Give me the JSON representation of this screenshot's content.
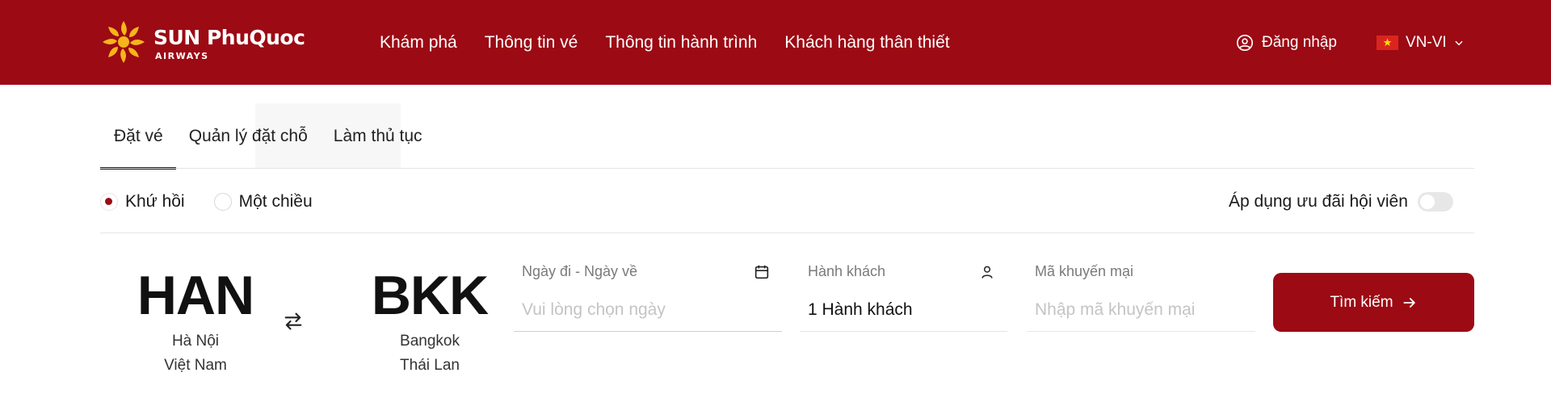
{
  "brand": {
    "name_sun": "SUN",
    "name_rest": "PhuQuoc",
    "sub": "AIRWAYS"
  },
  "nav": [
    {
      "label": "Khám phá"
    },
    {
      "label": "Thông tin vé"
    },
    {
      "label": "Thông tin hành trình"
    },
    {
      "label": "Khách hàng thân thiết"
    }
  ],
  "header": {
    "login_label": "Đăng nhập",
    "lang_label": "VN-VI"
  },
  "tabs": [
    {
      "label": "Đặt vé",
      "active": true
    },
    {
      "label": "Quản lý đặt chỗ",
      "active": false
    },
    {
      "label": "Làm thủ tục",
      "active": false
    }
  ],
  "trip_type": {
    "round_trip": "Khứ hồi",
    "one_way": "Một chiều",
    "selected": "round_trip"
  },
  "member_toggle": {
    "label": "Áp dụng ưu đãi hội viên",
    "on": false
  },
  "origin": {
    "code": "HAN",
    "city": "Hà Nội",
    "country": "Việt Nam"
  },
  "destination": {
    "code": "BKK",
    "city": "Bangkok",
    "country": "Thái Lan"
  },
  "date_field": {
    "label": "Ngày đi - Ngày về",
    "placeholder": "Vui lòng chọn ngày",
    "value": ""
  },
  "pax_field": {
    "label": "Hành khách",
    "value": "1 Hành khách"
  },
  "promo_field": {
    "label": "Mã khuyến mại",
    "placeholder": "Nhập mã khuyến mại",
    "value": ""
  },
  "search_button": {
    "label": "Tìm kiếm"
  },
  "colors": {
    "brand": "#9c0a14",
    "accent_gold": "#f5b51b"
  },
  "icons": [
    "sun-logo-icon",
    "user-circle-icon",
    "vietnam-flag-icon",
    "chevron-down-icon",
    "swap-icon",
    "calendar-icon",
    "person-icon",
    "arrow-right-icon"
  ]
}
